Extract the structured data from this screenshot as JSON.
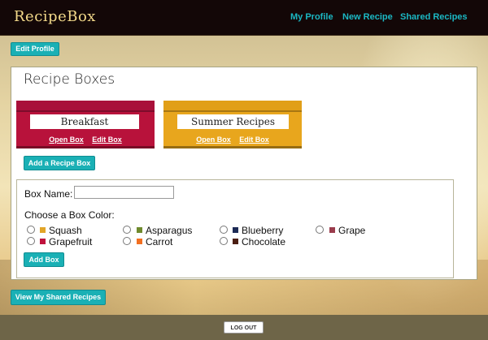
{
  "app": {
    "brand": "RecipeBox"
  },
  "nav": {
    "my_profile": "My Profile",
    "new_recipe": "New Recipe",
    "shared_recipes": "Shared Recipes"
  },
  "buttons": {
    "edit_profile": "Edit Profile",
    "add_recipe_box": "Add a Recipe Box",
    "add_box": "Add Box",
    "view_shared": "View My Shared Recipes",
    "logout": "LOG OUT"
  },
  "panel": {
    "title": "Recipe Boxes"
  },
  "boxes": [
    {
      "name": "Breakfast",
      "color": "#b8123b",
      "open": "Open Box",
      "edit": "Edit Box"
    },
    {
      "name": "Summer Recipes",
      "color": "#e8a61d",
      "open": "Open Box",
      "edit": "Edit Box"
    }
  ],
  "form": {
    "box_name_label": "Box Name:",
    "box_name_value": "",
    "color_label": "Choose a Box Color:",
    "colors": [
      {
        "name": "Squash",
        "hex": "#e2a528"
      },
      {
        "name": "Asparagus",
        "hex": "#6f8a2d"
      },
      {
        "name": "Blueberry",
        "hex": "#1c2a55"
      },
      {
        "name": "Grape",
        "hex": "#9a3c4c"
      },
      {
        "name": "Grapefruit",
        "hex": "#c0123d"
      },
      {
        "name": "Carrot",
        "hex": "#f26f21"
      },
      {
        "name": "Chocolate",
        "hex": "#4b1e12"
      }
    ]
  }
}
